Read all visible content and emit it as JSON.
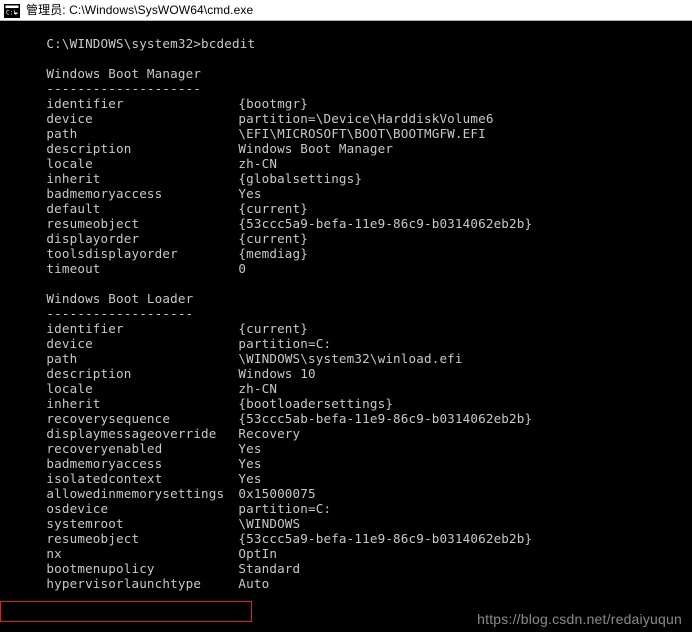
{
  "window": {
    "title": "管理员: C:\\Windows\\SysWOW64\\cmd.exe",
    "icon": "console-icon",
    "background_color": "#000000",
    "text_color": "#c8c8c8",
    "titlebar_color": "#ffffff"
  },
  "console": {
    "prompt_line": "C:\\WINDOWS\\system32>bcdedit",
    "sections": [
      {
        "heading": "Windows Boot Manager",
        "underline": "--------------------",
        "rows": [
          {
            "label": "identifier",
            "value": "{bootmgr}"
          },
          {
            "label": "device",
            "value": "partition=\\Device\\HarddiskVolume6"
          },
          {
            "label": "path",
            "value": "\\EFI\\MICROSOFT\\BOOT\\BOOTMGFW.EFI"
          },
          {
            "label": "description",
            "value": "Windows Boot Manager"
          },
          {
            "label": "locale",
            "value": "zh-CN"
          },
          {
            "label": "inherit",
            "value": "{globalsettings}"
          },
          {
            "label": "badmemoryaccess",
            "value": "Yes"
          },
          {
            "label": "default",
            "value": "{current}"
          },
          {
            "label": "resumeobject",
            "value": "{53ccc5a9-befa-11e9-86c9-b0314062eb2b}"
          },
          {
            "label": "displayorder",
            "value": "{current}"
          },
          {
            "label": "toolsdisplayorder",
            "value": "{memdiag}"
          },
          {
            "label": "timeout",
            "value": "0"
          }
        ]
      },
      {
        "heading": "Windows Boot Loader",
        "underline": "-------------------",
        "rows": [
          {
            "label": "identifier",
            "value": "{current}"
          },
          {
            "label": "device",
            "value": "partition=C:"
          },
          {
            "label": "path",
            "value": "\\WINDOWS\\system32\\winload.efi"
          },
          {
            "label": "description",
            "value": "Windows 10"
          },
          {
            "label": "locale",
            "value": "zh-CN"
          },
          {
            "label": "inherit",
            "value": "{bootloadersettings}"
          },
          {
            "label": "recoverysequence",
            "value": "{53ccc5ab-befa-11e9-86c9-b0314062eb2b}"
          },
          {
            "label": "displaymessageoverride",
            "value": "Recovery"
          },
          {
            "label": "recoveryenabled",
            "value": "Yes"
          },
          {
            "label": "badmemoryaccess",
            "value": "Yes"
          },
          {
            "label": "isolatedcontext",
            "value": "Yes"
          },
          {
            "label": "allowedinmemorysettings",
            "value": "0x15000075"
          },
          {
            "label": "osdevice",
            "value": "partition=C:"
          },
          {
            "label": "systemroot",
            "value": "\\WINDOWS"
          },
          {
            "label": "resumeobject",
            "value": "{53ccc5a9-befa-11e9-86c9-b0314062eb2b}"
          },
          {
            "label": "nx",
            "value": "OptIn"
          },
          {
            "label": "bootmenupolicy",
            "value": "Standard"
          },
          {
            "label": "hypervisorlaunchtype",
            "value": "Auto"
          }
        ]
      }
    ]
  },
  "annotation": {
    "highlight_color": "#e02020",
    "highlighted_row_label": "hypervisorlaunchtype",
    "highlighted_row_value": "Auto"
  },
  "watermark": {
    "text": "https://blog.csdn.net/redaiyuqun"
  }
}
